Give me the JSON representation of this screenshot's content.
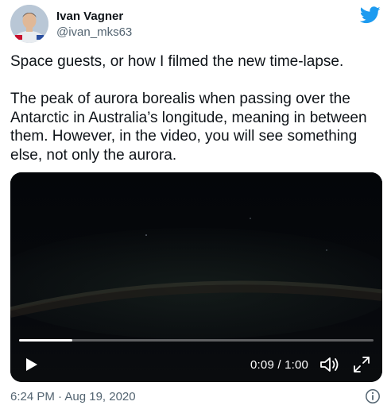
{
  "author": {
    "name": "Ivan Vagner",
    "handle": "@ivan_mks63",
    "avatar_icon": "astronaut-avatar"
  },
  "brand": {
    "icon": "twitter-bird-icon",
    "color": "#1d9bf0"
  },
  "tweet": {
    "paragraphs": [
      "Space guests, or how I filmed the new time-lapse.",
      "The peak of aurora borealis when passing over the Antarctic in Australia’s longitude, meaning in between them. However, in the video, you will see something else, not only the aurora."
    ]
  },
  "video": {
    "time_display": "0:09 / 1:00",
    "progress_fraction": 0.15,
    "controls": [
      "play-icon",
      "volume-icon",
      "fullscreen-icon"
    ]
  },
  "footer": {
    "timestamp": "6:24 PM · Aug 19, 2020",
    "info_icon": "info-icon"
  },
  "colors": {
    "text_primary": "#0f1419",
    "text_secondary": "#536471",
    "video_background": "#05070a"
  }
}
